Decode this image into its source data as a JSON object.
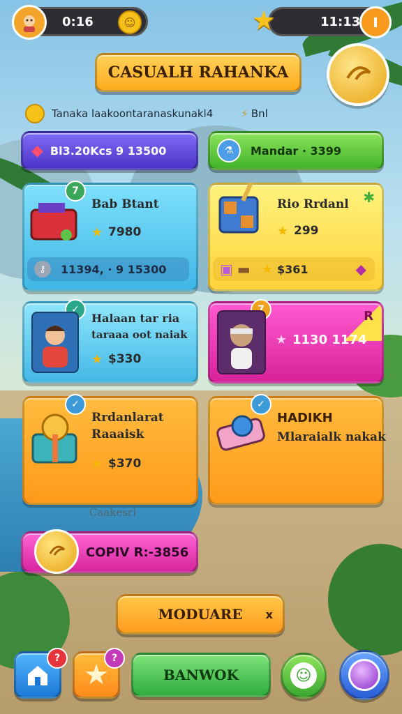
{
  "hud": {
    "left_value": "0:16",
    "right_value": "11:13"
  },
  "title_banner": "CASUALH RAHANKA",
  "info_line": {
    "text": "Tanaka laakoontaranaskunakl4",
    "side_text": "Bnl"
  },
  "top_buttons": [
    {
      "label": "Bl3.20Kcs 9 13500"
    },
    {
      "label": "Mandar · 3399"
    }
  ],
  "cards": [
    {
      "title": "Bab Btant",
      "price": "7980",
      "footer": "11394, · 9 15300",
      "badge": "7"
    },
    {
      "title": "Rio Rrdanl",
      "price": "299",
      "footer": "$361",
      "badge": ""
    },
    {
      "title": "Halaan tar ria",
      "subtitle": "taraaa oot naiak",
      "price": "$330",
      "badge": ""
    },
    {
      "title": "1130 1174",
      "corner": "R",
      "badge": "7"
    },
    {
      "title": "Rrdanlarat",
      "subtitle": "Raaaisk",
      "price": "$370",
      "badge": ""
    },
    {
      "title": "HADIKH",
      "subtitle": "Mlaraialk nakak",
      "badge": ""
    }
  ],
  "caption": "Caakesrl",
  "copy_button": "COPIV R:-3856",
  "module_button": {
    "label": "MODUARE",
    "close": "x"
  },
  "bottom_nav": {
    "main_label": "BANWOK",
    "home_badge": "?",
    "star_badge": "?"
  },
  "colors": {
    "orange": "#ffa51f",
    "blue_card": "#4fc6ee",
    "yellow_card": "#ffe36a",
    "pink_card": "#ee35b5",
    "green_btn": "#56c93a",
    "purple_btn": "#6a4fe0"
  }
}
